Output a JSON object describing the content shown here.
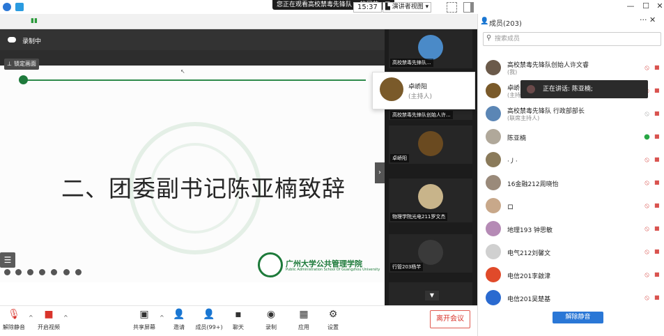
{
  "banner": {
    "text": "您正在观看高校禁毒先锋队 ...的屏幕",
    "menu_icon": "menu-icon"
  },
  "toolbar": {
    "clock": "15:37",
    "view_mode": "演讲者视图"
  },
  "recording": {
    "label": "录制中"
  },
  "lock_screen": {
    "label": "锁定画面"
  },
  "slide": {
    "title": "二、团委副书记陈亚楠致辞",
    "school_name": "广州大学公共管理学院",
    "school_en": "Public Administration School Of Guangzhou University"
  },
  "strip": {
    "tiles": [
      {
        "name": "高校禁毒先锋队..."
      },
      {
        "name": "高校禁毒先锋队创始人许..."
      },
      {
        "name": "卓峤阳"
      },
      {
        "name": "物理学院光电211罗文杰"
      },
      {
        "name": "行管203杨芊"
      }
    ]
  },
  "host_popup": {
    "name": "卓峤阳",
    "role": "(主持人)"
  },
  "bottom": {
    "unmute": "解除静音",
    "start_video": "开启视频",
    "share": "共享屏幕",
    "invite": "邀请",
    "members": "成员(99+)",
    "chat": "聊天",
    "record": "录制",
    "apps": "应用",
    "settings": "设置",
    "leave": "离开会议"
  },
  "panel": {
    "title": "成员(203)",
    "search_placeholder": "搜索成员",
    "speaking_tip": "正在讲话: 陈亚楠;",
    "unmute_all": "解除静音",
    "members": [
      {
        "name": "高校禁毒先锋队创始人许文睿",
        "role": "(我)",
        "mic": "off",
        "color": "#6b5a4a"
      },
      {
        "name": "卓峤",
        "role": "(主持",
        "mic": "off",
        "color": "#7a5a2a"
      },
      {
        "name": "高校禁毒先锋队 行政部部长",
        "role": "(联席主持人)",
        "mic": "muted-grey",
        "color": "#5b86b5"
      },
      {
        "name": "陈亚楠",
        "role": "",
        "mic": "on",
        "color": "#b0a89a"
      },
      {
        "name": "·丿·",
        "role": "",
        "mic": "off",
        "color": "#8a7a5a"
      },
      {
        "name": "16金融212周晓怡",
        "role": "",
        "mic": "off",
        "color": "#9a8a7a"
      },
      {
        "name": "ロ",
        "role": "",
        "mic": "off",
        "color": "#c8a88a"
      },
      {
        "name": "地理193 钟思敏",
        "role": "",
        "mic": "off",
        "color": "#b58ab5"
      },
      {
        "name": "电气212刘馨文",
        "role": "",
        "mic": "off",
        "color": "#d0d0d0"
      },
      {
        "name": "电信201李啟津",
        "role": "",
        "mic": "off",
        "color": "#e04a2a"
      },
      {
        "name": "电信201吴楚基",
        "role": "",
        "mic": "off",
        "color": "#2a6ad0"
      }
    ]
  }
}
